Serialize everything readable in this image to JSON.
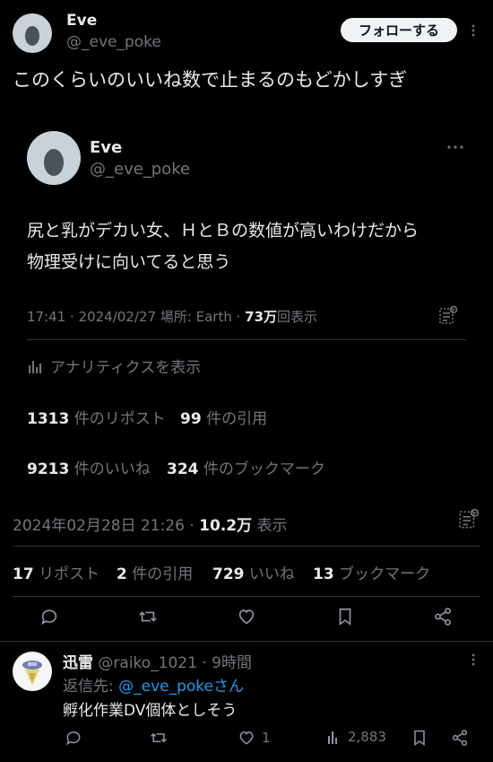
{
  "tweet": {
    "author_name": "Eve",
    "author_handle": "@_eve_poke",
    "follow_label": "フォローする",
    "text": "このくらいのいいね数で止まるのもどかしすぎ",
    "timestamp": "2024年02月28日 21:26",
    "views_sep": "·",
    "views_count": "10.2万",
    "views_label": "表示",
    "stats": {
      "retweets_count": "17",
      "retweets_label": "リポスト",
      "quotes_count": "2",
      "quotes_label": "件の引用",
      "likes_count": "729",
      "likes_label": "いいね",
      "bookmarks_count": "13",
      "bookmarks_label": "ブックマーク"
    }
  },
  "quoted": {
    "author_name": "Eve",
    "author_handle": "@_eve_poke",
    "text_line1": "尻と乳がデカい女、ＨとＢの数値が高いわけだから",
    "text_line2": "物理受けに向いてると思う",
    "meta_time": "17:41 · 2024/02/27",
    "meta_location": "場所: Earth ·",
    "meta_views_count": "73万",
    "meta_views_label": "回表示",
    "analytics_label": "アナリティクスを表示",
    "reposts_count": "1313",
    "reposts_label": "件のリポスト",
    "quotes_count": "99",
    "quotes_label": "件の引用",
    "likes_count": "9213",
    "likes_label": "件のいいね",
    "bookmarks_count": "324",
    "bookmarks_label": "件のブックマーク"
  },
  "reply": {
    "author_name": "迅雷",
    "author_handle": "@raiko_1021",
    "time": "· 9時間",
    "replying_prefix": "返信先:",
    "replying_handle": "@_eve_poke",
    "replying_suffix": "さん",
    "text": "孵化作業DV個体としそう",
    "likes": "1",
    "views": "2,883"
  },
  "colors": {
    "background": "#000000",
    "text": "#e7e9ea",
    "muted": "#71767b",
    "link": "#1d9bf0",
    "divider": "#2f3336"
  }
}
